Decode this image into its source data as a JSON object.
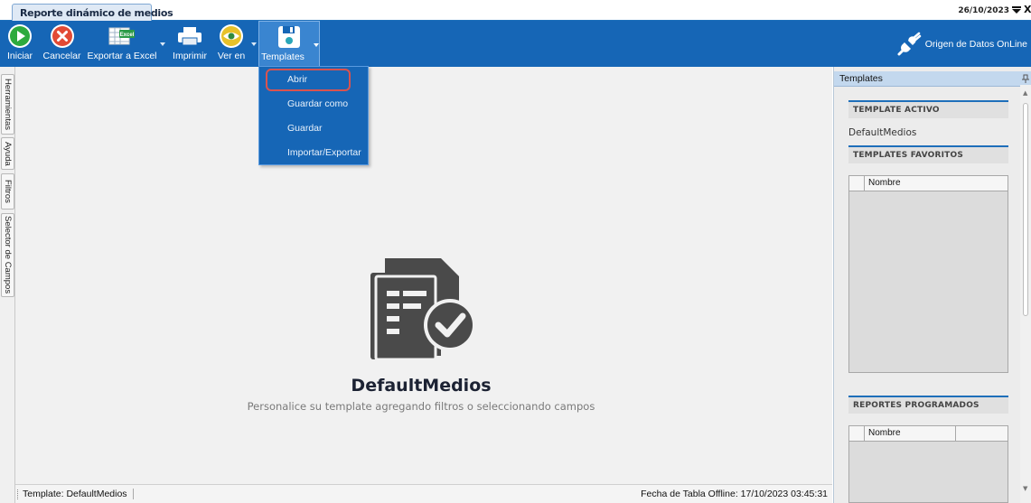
{
  "window": {
    "tab_title": "Reporte dinámico de medios",
    "date": "26/10/2023",
    "close_glyph": "X"
  },
  "toolbar": {
    "buttons": [
      {
        "label": "Iniciar",
        "icon": "play-icon"
      },
      {
        "label": "Cancelar",
        "icon": "cancel-icon"
      },
      {
        "label": "Exportar a Excel",
        "icon": "excel-icon"
      },
      {
        "label": "Imprimir",
        "icon": "printer-icon"
      },
      {
        "label": "Ver en",
        "icon": "eye-icon"
      },
      {
        "label": "Templates",
        "icon": "save-icon"
      }
    ],
    "excel_badge": "Excel",
    "datasource_label": "Origen de Datos OnLine",
    "accent_color": "#1666b6"
  },
  "templates_menu": {
    "items": [
      "Abrir",
      "Guardar como",
      "Guardar",
      "Importar/Exportar"
    ],
    "highlighted": "Abrir"
  },
  "left_tabs": [
    "Herramientas",
    "Ayuda",
    "Filtros",
    "Selector de Campos"
  ],
  "main": {
    "title": "DefaultMedios",
    "hint": "Personalice su template agregando filtros o seleccionando campos"
  },
  "statusbar": {
    "template": "Template: DefaultMedios",
    "offline_date": "Fecha de Tabla Offline: 17/10/2023 03:45:31"
  },
  "right_panel": {
    "title": "Templates",
    "active_header": "TEMPLATE ACTIVO",
    "active_value": "DefaultMedios",
    "favorites_header": "TEMPLATES FAVORITOS",
    "favorites_column": "Nombre",
    "scheduled_header": "REPORTES PROGRAMADOS",
    "scheduled_column": "Nombre"
  }
}
